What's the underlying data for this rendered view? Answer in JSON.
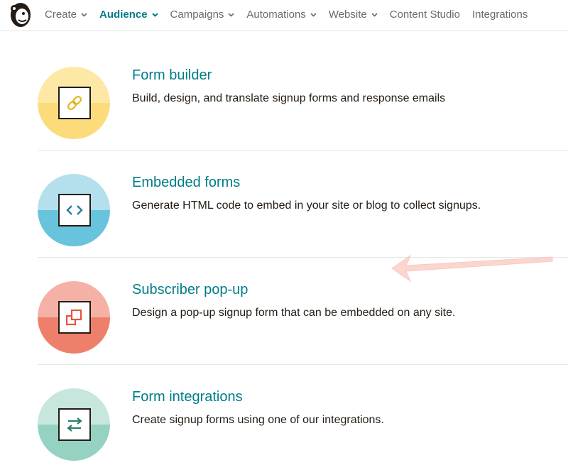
{
  "nav": {
    "logo_icon": "mailchimp-freddie-logo",
    "items": [
      {
        "label": "Create",
        "has_dropdown": true,
        "active": false
      },
      {
        "label": "Audience",
        "has_dropdown": true,
        "active": true
      },
      {
        "label": "Campaigns",
        "has_dropdown": true,
        "active": false
      },
      {
        "label": "Automations",
        "has_dropdown": true,
        "active": false
      },
      {
        "label": "Website",
        "has_dropdown": true,
        "active": false
      },
      {
        "label": "Content Studio",
        "has_dropdown": false,
        "active": false
      },
      {
        "label": "Integrations",
        "has_dropdown": false,
        "active": false
      }
    ]
  },
  "options": [
    {
      "title": "Form builder",
      "description": "Build, design, and translate signup forms and response emails",
      "icon": "link-icon",
      "color_light": "#fde8a6",
      "color_dark": "#fcdc7a"
    },
    {
      "title": "Embedded forms",
      "description": "Generate HTML code to embed in your site or blog to collect signups.",
      "icon": "code-icon",
      "color_light": "#b3e0ec",
      "color_dark": "#68c3dc"
    },
    {
      "title": "Subscriber pop-up",
      "description": "Design a pop-up signup form that can be embedded on any site.",
      "icon": "popup-icon",
      "color_light": "#f5b1a6",
      "color_dark": "#ee7f6b"
    },
    {
      "title": "Form integrations",
      "description": "Create signup forms using one of our integrations.",
      "icon": "swap-arrows-icon",
      "color_light": "#c7e6de",
      "color_dark": "#95d2c2"
    }
  ],
  "colors": {
    "accent": "#007c89",
    "text": "#241c15",
    "annotation_arrow": "#f8c8c0"
  }
}
